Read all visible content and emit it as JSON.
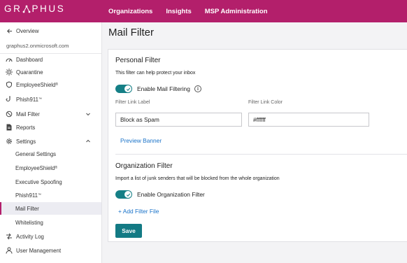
{
  "brand": {
    "logo_text_left": "GR",
    "logo_text_right": "PHUS",
    "accent": "#b31f6b",
    "teal": "#137a84"
  },
  "topnav": [
    "Organizations",
    "Insights",
    "MSP Administration"
  ],
  "sidebar": {
    "overview": "Overview",
    "domain": "graphus2.onmicrosoft.com",
    "items": [
      {
        "label": "Dashboard",
        "icon": "dashboard-icon"
      },
      {
        "label": "Quarantine",
        "icon": "quarantine-icon"
      },
      {
        "label": "EmployeeShield",
        "sup": "®",
        "icon": "shield-icon"
      },
      {
        "label": "Phish911",
        "sup": "™",
        "icon": "phish-icon"
      },
      {
        "label": "Mail Filter",
        "icon": "mail-filter-icon"
      },
      {
        "label": "Reports",
        "icon": "reports-icon"
      },
      {
        "label": "Settings",
        "icon": "gear-icon"
      }
    ],
    "settings_sub": [
      {
        "label": "General Settings"
      },
      {
        "label": "EmployeeShield",
        "sup": "®"
      },
      {
        "label": "Executive Spoofing"
      },
      {
        "label": "Phish911",
        "sup": "™"
      },
      {
        "label": "Mail Filter"
      },
      {
        "label": "Whitelisting"
      }
    ],
    "bottom": [
      {
        "label": "Activity Log",
        "icon": "activity-log-icon"
      },
      {
        "label": "User Management",
        "icon": "user-icon"
      }
    ]
  },
  "page": {
    "title": "Mail Filter",
    "personal": {
      "title": "Personal Filter",
      "description": "This filter can help protect your inbox",
      "toggle_label": "Enable Mail Filtering",
      "toggle_on": true,
      "link_label_caption": "Filter Link Label",
      "link_label_value": "Block as Spam",
      "link_color_caption": "Filter Link Color",
      "link_color_value": "#ffffff",
      "preview_banner": "Preview Banner"
    },
    "organization": {
      "title": "Organization Filter",
      "description": "Import a list of junk senders that will be blocked from the whole organization",
      "toggle_label": "Enable Organization Filter",
      "toggle_on": true,
      "add_file": "+ Add Filter File"
    },
    "save": "Save"
  }
}
